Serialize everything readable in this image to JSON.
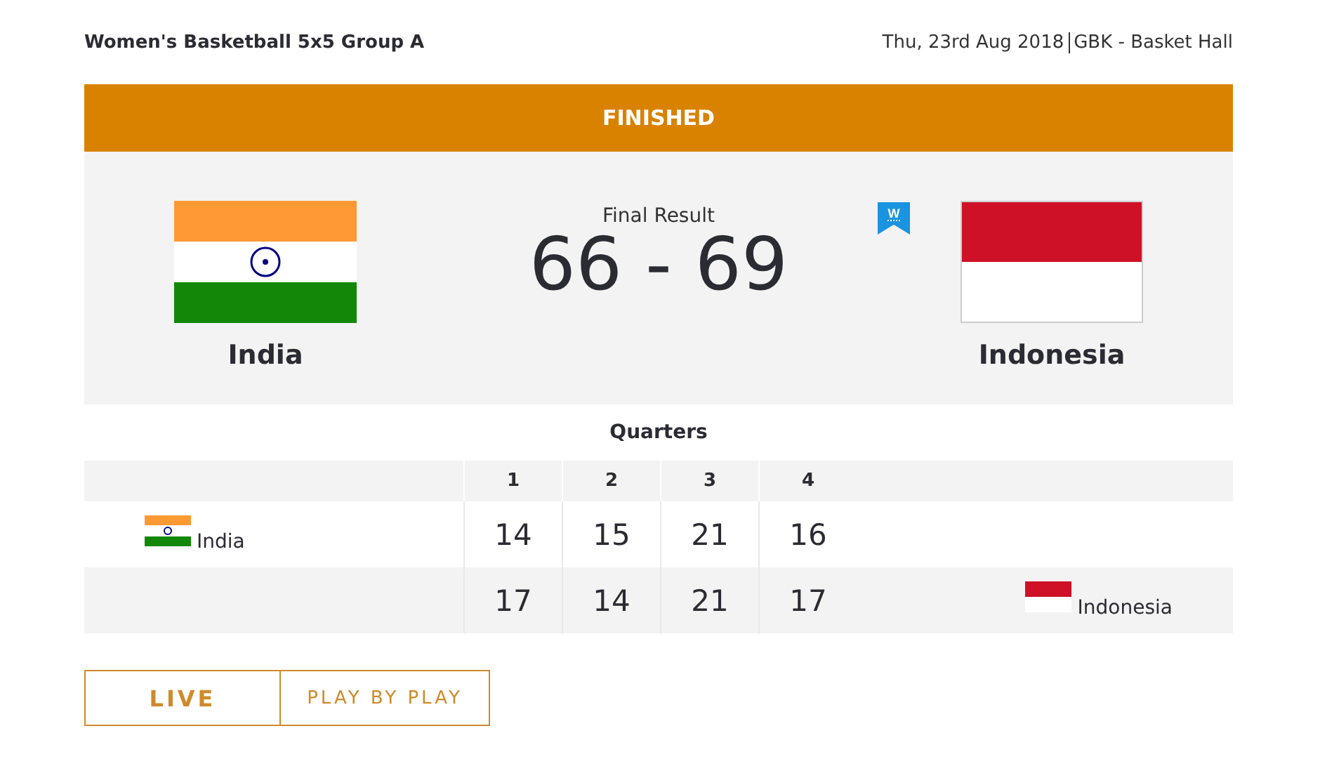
{
  "event": "Women's Basketball 5x5 Group A",
  "date": "Thu, 23rd Aug 2018",
  "venue": "GBK - Basket Hall",
  "status": "FINISHED",
  "result_label": "Final Result",
  "score": "66 - 69",
  "winner_badge": "W",
  "teams": [
    {
      "name": "India",
      "flag": {
        "kind": "india"
      },
      "winner": false
    },
    {
      "name": "Indonesia",
      "flag": {
        "kind": "indonesia"
      },
      "winner": true
    }
  ],
  "quarters": {
    "title": "Quarters",
    "columns": [
      "1",
      "2",
      "3",
      "4"
    ],
    "rows": [
      {
        "kind": "home",
        "team": "India",
        "flag": {
          "kind": "india"
        },
        "scores": [
          "14",
          "15",
          "21",
          "16"
        ]
      },
      {
        "kind": "away",
        "team": "Indonesia",
        "flag": {
          "kind": "indonesia"
        },
        "scores": [
          "17",
          "14",
          "21",
          "17"
        ]
      }
    ]
  },
  "tabs": [
    {
      "label": "LIVE",
      "selected": true
    },
    {
      "label": "PLAY BY PLAY",
      "selected": false
    }
  ]
}
